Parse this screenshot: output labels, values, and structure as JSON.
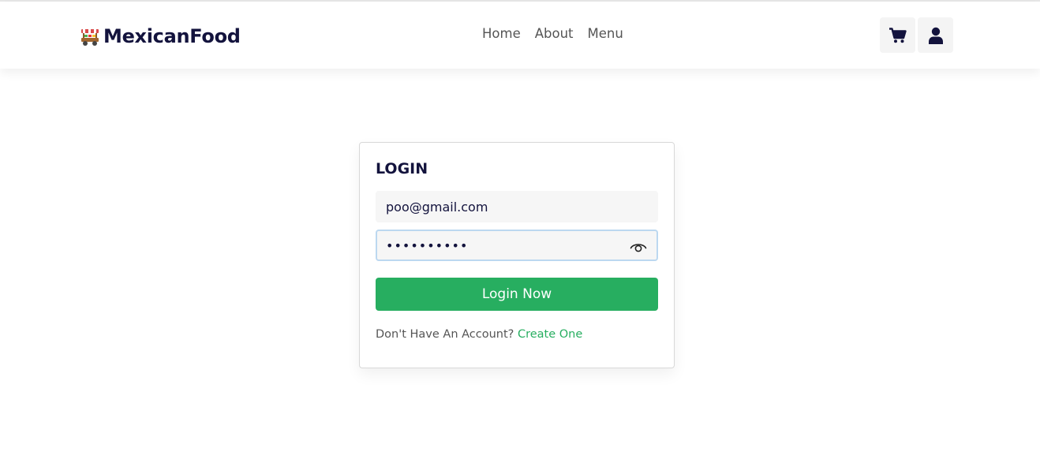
{
  "header": {
    "brand": "MexicanFood",
    "brand_icon": "food-cart-icon",
    "nav": [
      {
        "label": "Home"
      },
      {
        "label": "About"
      },
      {
        "label": "Menu"
      }
    ],
    "cart_icon": "shopping-cart-icon",
    "user_icon": "user-icon"
  },
  "login": {
    "title": "LOGIN",
    "email_value": "poo@gmail.com",
    "password_value": "••••••••••",
    "show_password_icon": "eye-icon",
    "submit_label": "Login Now",
    "no_account_text": "Don't Have An Account?",
    "create_link": "Create One"
  },
  "colors": {
    "brand_dark": "#13133d",
    "accent_green": "#27ae60",
    "focus_border": "#bcd8f0"
  }
}
